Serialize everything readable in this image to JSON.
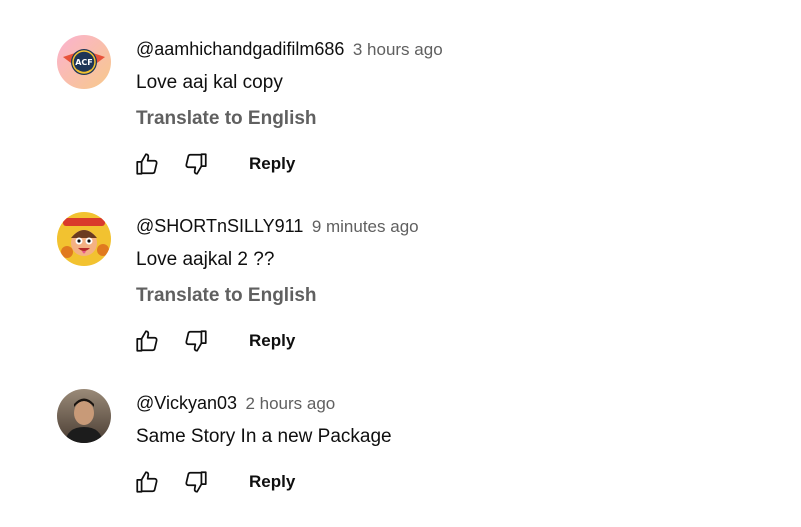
{
  "comments": [
    {
      "author": "@aamhichandgadifilm686",
      "time": "3 hours ago",
      "text": "Love aaj kal copy",
      "translate_label": "Translate to English",
      "reply_label": "Reply",
      "avatar_text": "ACF",
      "avatar_colors": [
        "#f9a1c0",
        "#f6c27a"
      ]
    },
    {
      "author": "@SHORTnSILLY911",
      "time": "9 minutes ago",
      "text": "Love aajkal 2 ??",
      "translate_label": "Translate to English",
      "reply_label": "Reply",
      "avatar_colors": [
        "#f2c230",
        "#e07a1f"
      ]
    },
    {
      "author": "@Vickyan03",
      "time": "2 hours ago",
      "text": "Same Story In a new Package",
      "reply_label": "Reply",
      "avatar_colors": [
        "#8a7560",
        "#3b2f26"
      ]
    }
  ]
}
